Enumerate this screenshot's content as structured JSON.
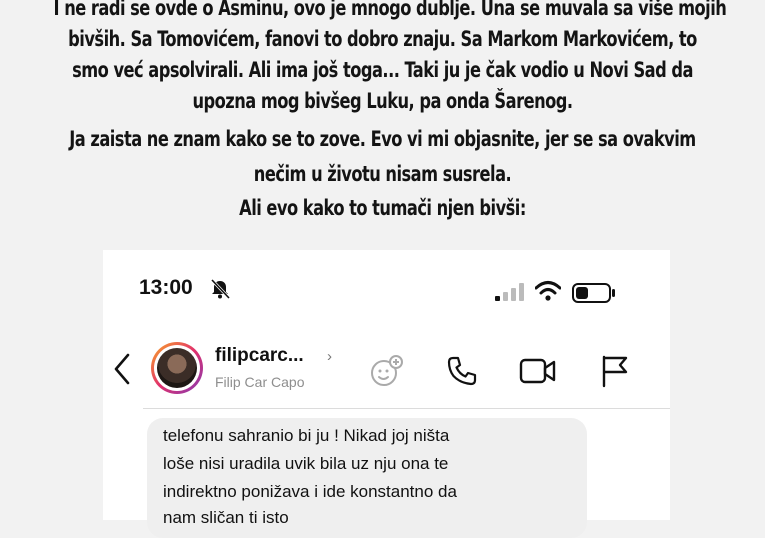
{
  "story": {
    "lines": [
      "I ne radi se ovde o Asminu, ovo je mnogo dublje. Una se muvala sa više mojih",
      "bivših. Sa Tomovićem, fanovi to dobro znaju. Sa Markom Markovićem, to",
      "smo već apsolvirali. Ali ima još toga... Taki ju je čak vodio u Novi Sad da",
      "upozna mog bivšeg Luku, pa onda Šarenog.",
      "Ja zaista ne znam kako se to zove. Evo vi mi objasnite, jer se sa ovakvim",
      "nečim u životu nisam susrela.",
      "Ali evo kako to tumači njen bivši:"
    ]
  },
  "status_bar": {
    "time": "13:00",
    "icons": [
      "bell-muted-icon",
      "signal-icon",
      "wifi-icon",
      "battery-icon"
    ]
  },
  "chat_header": {
    "username": "filipcarc...",
    "username_chevron": "›",
    "full_name": "Filip Car Capo",
    "actions": [
      "sticker-icon",
      "phone-icon",
      "video-icon",
      "flag-icon"
    ]
  },
  "message": {
    "lines": [
      "telefonu sahranio bi ju ! Nikad joj ništa",
      "loše nisi uradila uvik bila uz nju ona te",
      "indirektno ponižava i ide konstantno da",
      "nam sličan ti isto"
    ]
  },
  "colors": {
    "story_text": "#141414",
    "background": "#f2f2f2",
    "bubble": "#efefef",
    "secondary_text": "#8e8e8e"
  }
}
